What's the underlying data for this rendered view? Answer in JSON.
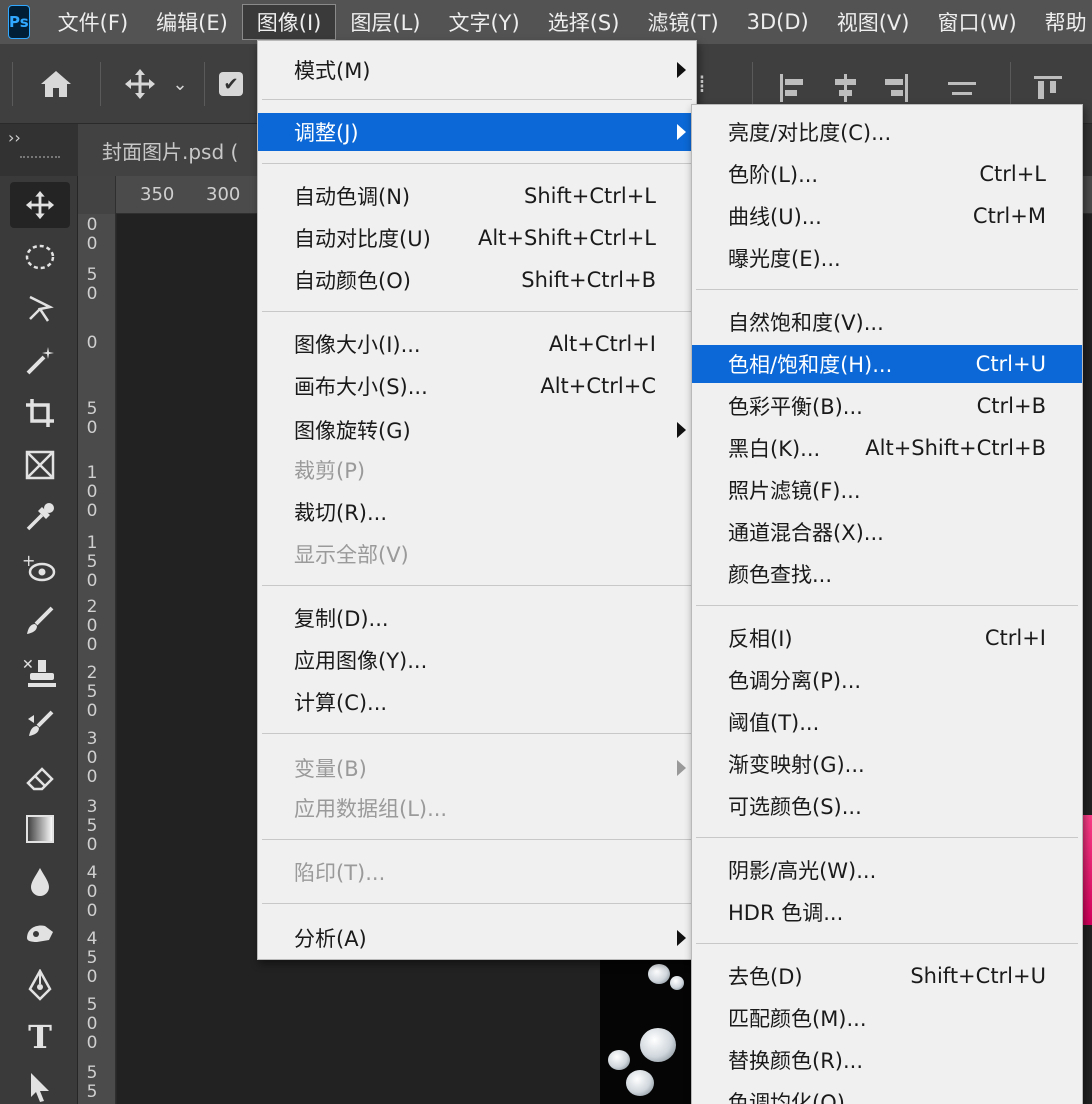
{
  "app": {
    "logo": "Ps"
  },
  "menubar": {
    "items": [
      "文件(F)",
      "编辑(E)",
      "图像(I)",
      "图层(L)",
      "文字(Y)",
      "选择(S)",
      "滤镜(T)",
      "3D(D)",
      "视图(V)",
      "窗口(W)",
      "帮助"
    ]
  },
  "options_bar": {
    "icons": [
      "home-icon",
      "move-icon",
      "chevron-down-icon",
      "checkbox-icon",
      "align-left-icon",
      "align-center-icon",
      "align-right-icon",
      "distribute-icon",
      "align-top-icon"
    ],
    "checkbox_mark": "✔"
  },
  "tabs": {
    "collapse": "››",
    "document": "封面图片.psd ("
  },
  "ruler": {
    "top": [
      "350",
      "300"
    ],
    "left": [
      "0\n0",
      "5\n0",
      "0",
      "5\n0",
      "1\n0\n0",
      "1\n5\n0",
      "2\n0\n0",
      "2\n5\n0",
      "3\n0\n0",
      "3\n5\n0",
      "4\n0\n0",
      "4\n5\n0",
      "5\n0\n0",
      "5\n5"
    ]
  },
  "toolbox": {
    "tools": [
      "move-tool-icon",
      "ellipse-marquee-icon",
      "lasso-icon",
      "magic-wand-icon",
      "crop-icon",
      "frame-icon",
      "eyedropper-icon",
      "spot-heal-icon",
      "brush-icon",
      "stamp-icon",
      "history-brush-icon",
      "eraser-icon",
      "gradient-icon",
      "blur-icon",
      "smudge-icon",
      "pen-icon",
      "type-icon",
      "path-select-icon"
    ]
  },
  "image_menu": {
    "items": [
      {
        "label": "模式(M)",
        "shortcut": "",
        "submenu": true
      },
      {
        "label": "调整(J)",
        "shortcut": "",
        "submenu": true,
        "highlighted": true
      },
      {
        "label": "自动色调(N)",
        "shortcut": "Shift+Ctrl+L"
      },
      {
        "label": "自动对比度(U)",
        "shortcut": "Alt+Shift+Ctrl+L"
      },
      {
        "label": "自动颜色(O)",
        "shortcut": "Shift+Ctrl+B"
      },
      {
        "label": "图像大小(I)...",
        "shortcut": "Alt+Ctrl+I"
      },
      {
        "label": "画布大小(S)...",
        "shortcut": "Alt+Ctrl+C"
      },
      {
        "label": "图像旋转(G)",
        "shortcut": "",
        "submenu": true
      },
      {
        "label": "裁剪(P)",
        "shortcut": "",
        "disabled": true
      },
      {
        "label": "裁切(R)...",
        "shortcut": ""
      },
      {
        "label": "显示全部(V)",
        "shortcut": "",
        "disabled": true
      },
      {
        "label": "复制(D)...",
        "shortcut": ""
      },
      {
        "label": "应用图像(Y)...",
        "shortcut": ""
      },
      {
        "label": "计算(C)...",
        "shortcut": ""
      },
      {
        "label": "变量(B)",
        "shortcut": "",
        "submenu": true,
        "disabled": true
      },
      {
        "label": "应用数据组(L)...",
        "shortcut": "",
        "disabled": true
      },
      {
        "label": "陷印(T)...",
        "shortcut": "",
        "disabled": true
      },
      {
        "label": "分析(A)",
        "shortcut": "",
        "submenu": true
      }
    ]
  },
  "adjust_menu": {
    "items": [
      {
        "label": "亮度/对比度(C)...",
        "shortcut": ""
      },
      {
        "label": "色阶(L)...",
        "shortcut": "Ctrl+L"
      },
      {
        "label": "曲线(U)...",
        "shortcut": "Ctrl+M"
      },
      {
        "label": "曝光度(E)...",
        "shortcut": ""
      },
      {
        "label": "自然饱和度(V)...",
        "shortcut": ""
      },
      {
        "label": "色相/饱和度(H)...",
        "shortcut": "Ctrl+U",
        "highlighted": true
      },
      {
        "label": "色彩平衡(B)...",
        "shortcut": "Ctrl+B"
      },
      {
        "label": "黑白(K)...",
        "shortcut": "Alt+Shift+Ctrl+B"
      },
      {
        "label": "照片滤镜(F)...",
        "shortcut": ""
      },
      {
        "label": "通道混合器(X)...",
        "shortcut": ""
      },
      {
        "label": "颜色查找...",
        "shortcut": ""
      },
      {
        "label": "反相(I)",
        "shortcut": "Ctrl+I"
      },
      {
        "label": "色调分离(P)...",
        "shortcut": ""
      },
      {
        "label": "阈值(T)...",
        "shortcut": ""
      },
      {
        "label": "渐变映射(G)...",
        "shortcut": ""
      },
      {
        "label": "可选颜色(S)...",
        "shortcut": ""
      },
      {
        "label": "阴影/高光(W)...",
        "shortcut": ""
      },
      {
        "label": "HDR 色调...",
        "shortcut": ""
      },
      {
        "label": "去色(D)",
        "shortcut": "Shift+Ctrl+U"
      },
      {
        "label": "匹配颜色(M)...",
        "shortcut": ""
      },
      {
        "label": "替换颜色(R)...",
        "shortcut": ""
      },
      {
        "label": "色调均化(Q)",
        "shortcut": ""
      }
    ]
  },
  "colors": {
    "highlight": "#0b68d6",
    "menu_bg": "#f0f0f0",
    "menubar_bg": "#535353"
  }
}
